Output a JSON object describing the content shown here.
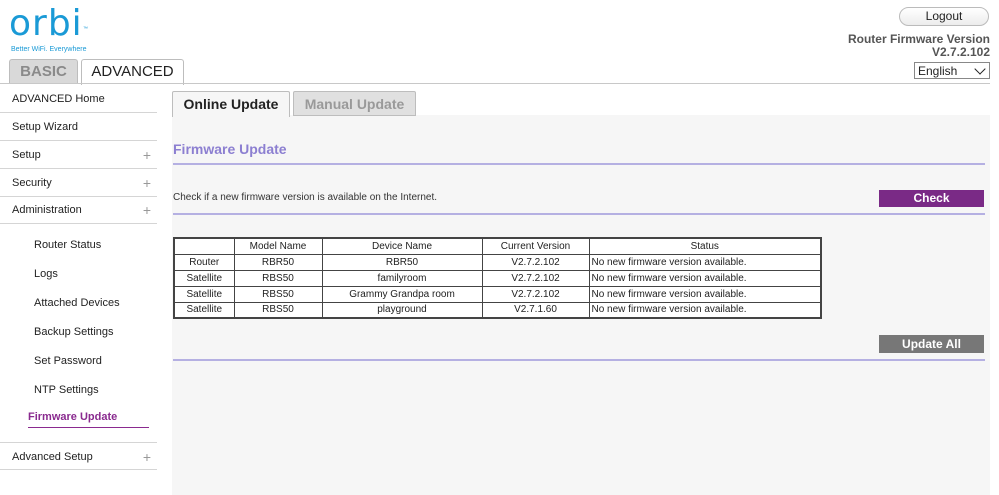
{
  "logo": {
    "text": "orbi",
    "trademark": "™",
    "tagline": "Better WiFi. Everywhere"
  },
  "header": {
    "logout_label": "Logout",
    "firmware_label": "Router Firmware Version",
    "firmware_version": "V2.7.2.102",
    "language_selected": "English"
  },
  "top_tabs": {
    "basic": "BASIC",
    "advanced": "ADVANCED"
  },
  "sidebar": {
    "items": [
      {
        "label": "ADVANCED Home",
        "expandable": false
      },
      {
        "label": "Setup Wizard",
        "expandable": false
      },
      {
        "label": "Setup",
        "expandable": true
      },
      {
        "label": "Security",
        "expandable": true
      },
      {
        "label": "Administration",
        "expandable": true
      }
    ],
    "admin_subitems": [
      "Router Status",
      "Logs",
      "Attached Devices",
      "Backup Settings",
      "Set Password",
      "NTP Settings"
    ],
    "active_subitem": "Firmware Update",
    "bottom_item": {
      "label": "Advanced Setup",
      "expandable": true
    },
    "plus_glyph": "+"
  },
  "sub_tabs": {
    "online": "Online Update",
    "manual": "Manual Update"
  },
  "main": {
    "section_title": "Firmware Update",
    "check_text": "Check if a new firmware version is available on the Internet.",
    "check_label": "Check",
    "update_all_label": "Update All",
    "table": {
      "headers": [
        "",
        "Model Name",
        "Device Name",
        "Current Version",
        "Status"
      ],
      "rows": [
        [
          "Router",
          "RBR50",
          "RBR50",
          "V2.7.2.102",
          "No new firmware version available."
        ],
        [
          "Satellite",
          "RBS50",
          "familyroom",
          "V2.7.2.102",
          "No new firmware version available."
        ],
        [
          "Satellite",
          "RBS50",
          "Grammy Grandpa room",
          "V2.7.2.102",
          "No new firmware version available."
        ],
        [
          "Satellite",
          "RBS50",
          "playground",
          "V2.7.1.60",
          "No new firmware version available."
        ]
      ]
    }
  },
  "colors": {
    "brand_blue": "#1a9ad6",
    "accent_purple": "#7a2a86",
    "title_lavender": "#8c7fd1",
    "divider_lavender": "#b5b0e2",
    "disabled_gray": "#777777"
  }
}
